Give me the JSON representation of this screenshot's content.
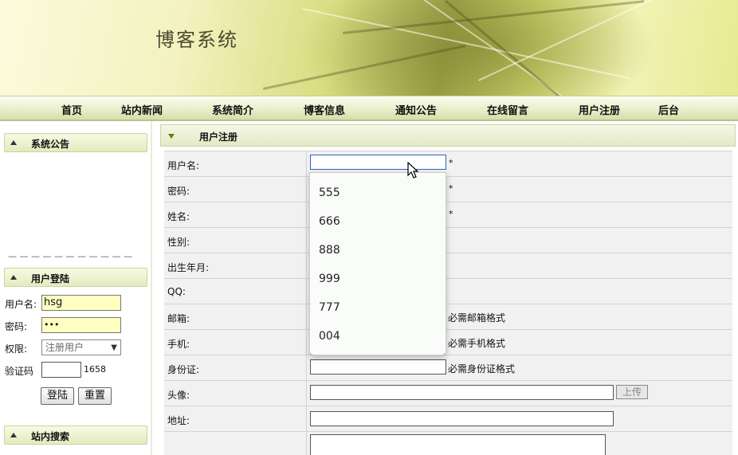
{
  "banner": {
    "title": "博客系统"
  },
  "nav": {
    "items": [
      "首页",
      "站内新闻",
      "系统简介",
      "博客信息",
      "通知公告",
      "在线留言",
      "用户注册",
      "后台"
    ]
  },
  "sidebar": {
    "notice_title": "系统公告",
    "login_title": "用户登陆",
    "username_label": "用户名:",
    "username_value": "hsg",
    "password_label": "密码:",
    "password_value": "•••",
    "role_label": "权限:",
    "role_value": "注册用户",
    "captcha_label": "验证码",
    "captcha_code": "1658",
    "login_button": "登陆",
    "reset_button": "重置",
    "search_title": "站内搜索"
  },
  "main": {
    "title": "用户注册",
    "fields": {
      "username": "用户名:",
      "password": "密码:",
      "name": "姓名:",
      "gender": "性别:",
      "birth": "出生年月:",
      "qq": "QQ:",
      "email": "邮箱:",
      "phone": "手机:",
      "idcard": "身份证:",
      "avatar": "头像:",
      "address": "地址:"
    },
    "required_mark": "*",
    "email_hint": "必需邮箱格式",
    "phone_hint": "必需手机格式",
    "idcard_hint": "必需身份证格式",
    "upload_label": "上传"
  },
  "autocomplete": {
    "options": [
      "555",
      "666",
      "888",
      "999",
      "777",
      "004"
    ]
  }
}
